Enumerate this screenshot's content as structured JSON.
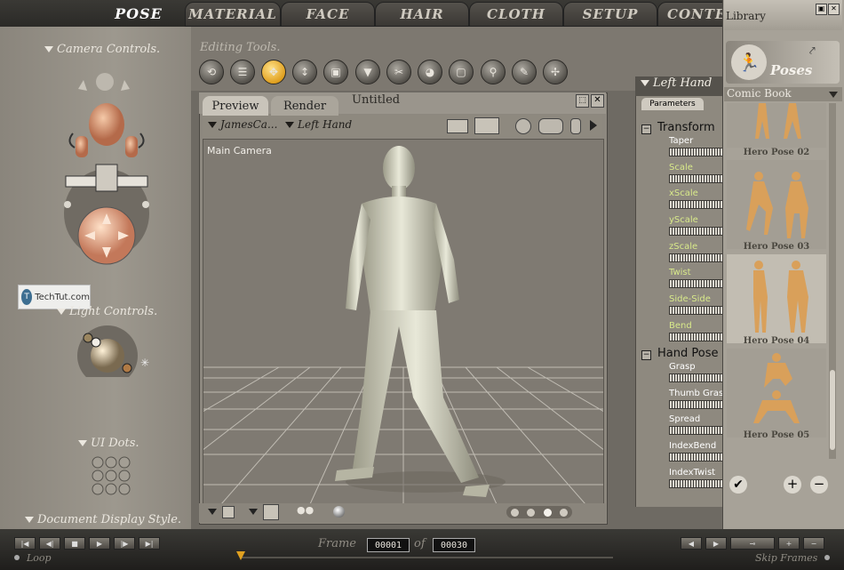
{
  "tabs": [
    "POSE",
    "MATERIAL",
    "FACE",
    "HAIR",
    "CLOTH",
    "SETUP",
    "CONTE"
  ],
  "left_panel": {
    "camera_controls": "Camera Controls.",
    "light_controls": "Light Controls.",
    "ui_dots": "UI Dots.",
    "document_display_style": "Document Display Style.",
    "watermark": "TechTut.com"
  },
  "editing_tools": {
    "label": "Editing Tools.",
    "tools": [
      "rotate",
      "twist",
      "translate",
      "translate-in-out",
      "scale",
      "taper",
      "chain-break",
      "color",
      "grouping",
      "view-magnifier",
      "morph-brush",
      "direct-manipulation"
    ]
  },
  "document": {
    "tabs": [
      "Preview",
      "Render"
    ],
    "title": "Untitled",
    "camera_select": "JamesCa...",
    "actor_select": "Left Hand",
    "viewport_label": "Main Camera"
  },
  "parameters": {
    "header": "Left Hand",
    "tab": "Parameters",
    "groups": [
      {
        "name": "Transform",
        "items": [
          "Taper",
          "Scale",
          "xScale",
          "yScale",
          "zScale",
          "Twist",
          "Side-Side",
          "Bend"
        ]
      },
      {
        "name": "Hand Pose",
        "items": [
          "Grasp",
          "Thumb Gras",
          "Spread",
          "IndexBend",
          "IndexTwist"
        ]
      }
    ]
  },
  "library": {
    "title": "Library",
    "category": "Poses",
    "folder": "Comic Book",
    "items": [
      "Hero Pose 02",
      "Hero Pose 03",
      "Hero Pose 04",
      "Hero Pose 05"
    ],
    "selected": "Hero Pose 04"
  },
  "animation": {
    "frame_label": "Frame",
    "of_label": "of",
    "current_frame": "00001",
    "total_frames": "00030",
    "loop": "Loop",
    "skip_frames": "Skip Frames"
  },
  "colors": {
    "accent": "#e0a020",
    "parameter_text": "#d8e98a",
    "panel": "#8e897f"
  }
}
